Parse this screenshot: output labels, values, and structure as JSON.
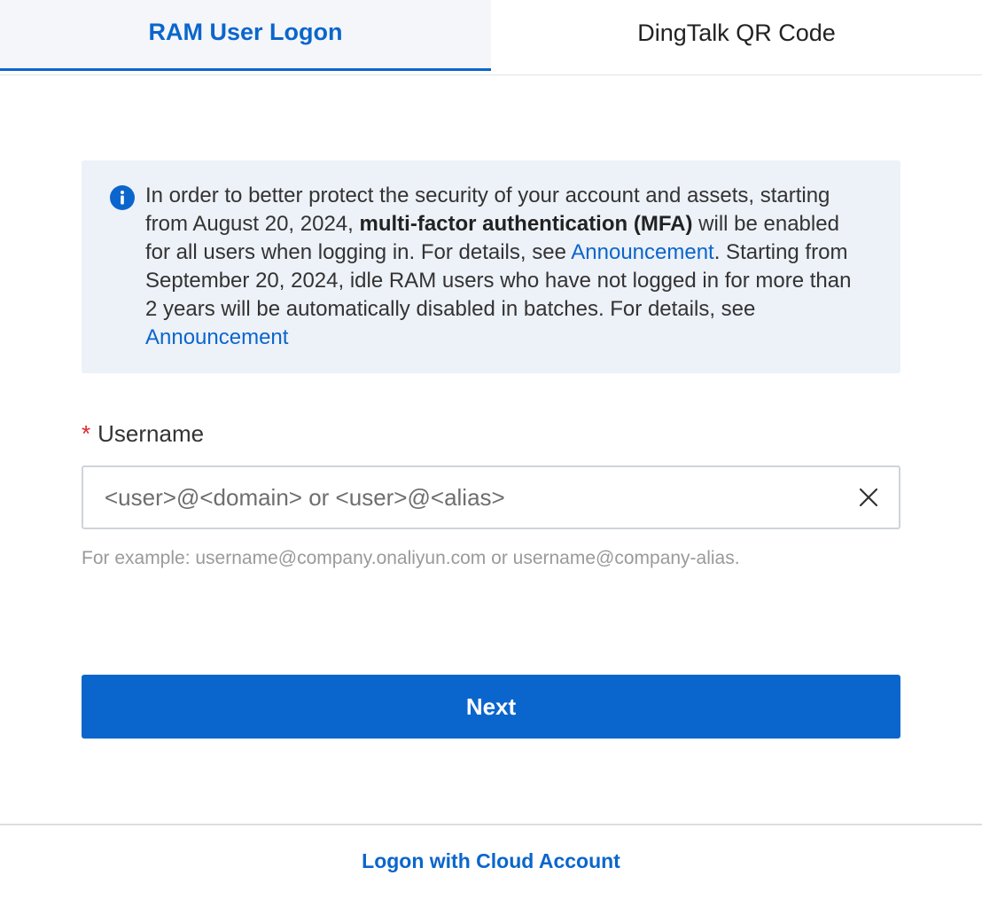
{
  "tabs": [
    {
      "label": "RAM User Logon",
      "active": true
    },
    {
      "label": "DingTalk QR Code",
      "active": false
    }
  ],
  "notice": {
    "icon": "info-icon",
    "part1": "In order to better protect the security of your account and assets, starting from August 20, 2024, ",
    "bold": "multi-factor authentication (MFA)",
    "part2": " will be enabled for all users when logging in. For details, see ",
    "link1": "Announcement",
    "part3": ". Starting from September 20, 2024, idle RAM users who have not logged in for more than 2 years will be automatically disabled in batches. For details, see ",
    "link2": "Announcement"
  },
  "username": {
    "required_mark": "*",
    "label": "Username",
    "value": "",
    "placeholder": "<user>@<domain> or <user>@<alias>",
    "hint": "For example: username@company.onaliyun.com or username@company-alias."
  },
  "actions": {
    "next_label": "Next"
  },
  "footer": {
    "link_label": "Logon with Cloud Account"
  },
  "colors": {
    "accent": "#0a66cc",
    "notice_bg": "#edf1f8",
    "required": "#d9262c"
  }
}
